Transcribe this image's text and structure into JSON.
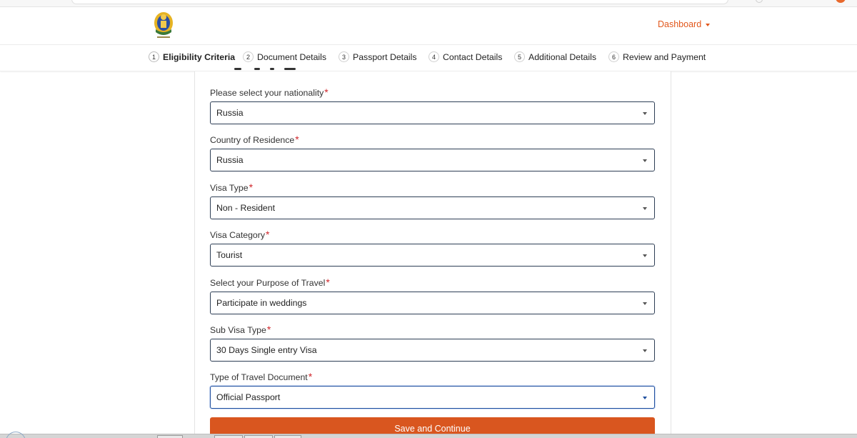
{
  "header": {
    "logo_icon": "national-emblem-logo-icon",
    "dashboard_label": "Dashboard"
  },
  "steps": [
    {
      "number": "1",
      "label": "Eligibility Criteria",
      "active": true
    },
    {
      "number": "2",
      "label": "Document Details",
      "active": false
    },
    {
      "number": "3",
      "label": "Passport Details",
      "active": false
    },
    {
      "number": "4",
      "label": "Contact Details",
      "active": false
    },
    {
      "number": "5",
      "label": "Additional Details",
      "active": false
    },
    {
      "number": "6",
      "label": "Review and Payment",
      "active": false
    }
  ],
  "form": {
    "required_mark": "*",
    "fields": [
      {
        "label": "Please select your nationality",
        "value": "Russia"
      },
      {
        "label": "Country of Residence",
        "value": "Russia"
      },
      {
        "label": "Visa Type",
        "value": "Non - Resident"
      },
      {
        "label": "Visa Category",
        "value": "Tourist"
      },
      {
        "label": "Select your Purpose of Travel",
        "value": "Participate in weddings"
      },
      {
        "label": "Sub Visa Type",
        "value": "30 Days Single entry Visa"
      },
      {
        "label": "Type of Travel Document",
        "value": "Official Passport"
      }
    ],
    "submit_label": "Save and Continue"
  },
  "colors": {
    "accent": "#e2571c",
    "button": "#d9561f",
    "required": "#d0262b",
    "field_border": "#2d3e55",
    "focus_border": "#1f4f9e"
  }
}
